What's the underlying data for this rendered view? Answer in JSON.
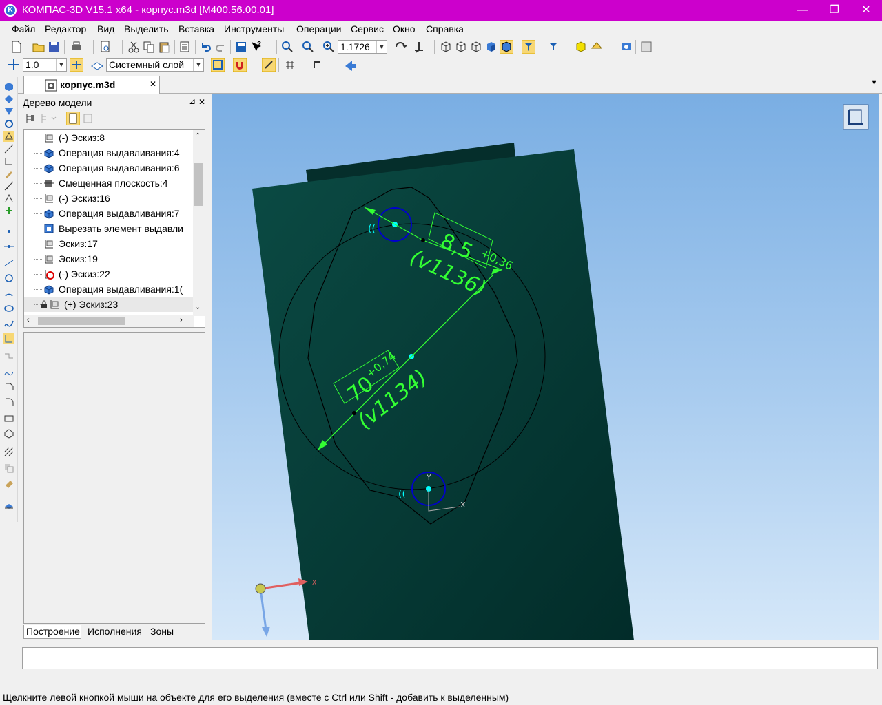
{
  "window": {
    "title": "КОМПАС-3D V15.1 x64 - корпус.m3d [М400.56.00.01]",
    "app_icon_letter": "K",
    "minimize": "—",
    "maximize": "❐",
    "close": "✕"
  },
  "menu": [
    "Файл",
    "Редактор",
    "Вид",
    "Выделить",
    "Вставка",
    "Инструменты",
    "Операции",
    "Сервис",
    "Окно",
    "Справка"
  ],
  "toolbar1": {
    "zoom_value": "1.1726"
  },
  "toolbar2": {
    "step_value": "1.0",
    "layer_value": "Системный слой"
  },
  "document_tab": {
    "label": "корпус.m3d",
    "close": "✕"
  },
  "tree_panel": {
    "title": "Дерево модели",
    "pin": "⊿",
    "close": "✕",
    "items": [
      {
        "label": "(-) Эскиз:8",
        "icon": "sketch"
      },
      {
        "label": "Операция выдавливания:4",
        "icon": "extrude"
      },
      {
        "label": "Операция выдавливания:6",
        "icon": "extrude"
      },
      {
        "label": "Смещенная плоскость:4",
        "icon": "plane"
      },
      {
        "label": "(-) Эскиз:16",
        "icon": "sketch"
      },
      {
        "label": "Операция выдавливания:7",
        "icon": "extrude"
      },
      {
        "label": "Вырезать элемент выдавли",
        "icon": "cut"
      },
      {
        "label": "Эскиз:17",
        "icon": "sketch"
      },
      {
        "label": "Эскиз:19",
        "icon": "sketch"
      },
      {
        "label": "(-) Эскиз:22",
        "icon": "sketch-error"
      },
      {
        "label": "Операция выдавливания:1(",
        "icon": "extrude"
      },
      {
        "label": "(+) Эскиз:23",
        "icon": "sketch-locked"
      }
    ],
    "tabs": [
      "Построение",
      "Исполнения",
      "Зоны"
    ]
  },
  "viewport": {
    "dim_top": {
      "value": "8,5",
      "tolerance": "+0,36",
      "variable": "(v1136)"
    },
    "dim_center": {
      "value": "70",
      "tolerance": "+0,74",
      "variable": "(v1134)"
    },
    "local_axis_x": "X",
    "local_axis_y": "Y",
    "global_axis_x": "X"
  },
  "status": {
    "hint": "Щелкните левой кнопкой мыши на объекте для его выделения (вместе с Ctrl или Shift - добавить к выделенным)"
  },
  "colors": {
    "titlebar": "#cc00cc",
    "body": "#063f3a",
    "dimension": "#33ff33",
    "hole": "#0000cc"
  }
}
